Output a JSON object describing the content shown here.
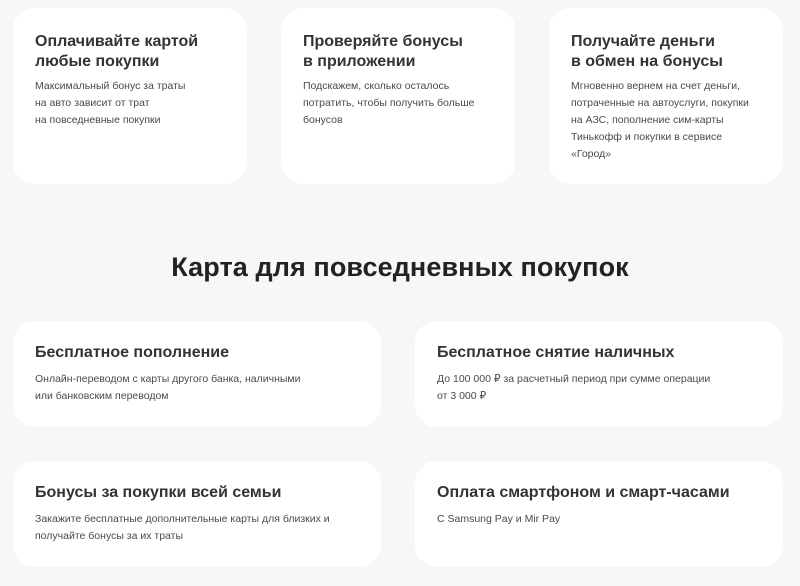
{
  "features": [
    {
      "title": "Оплачивайте картой\nлюбые покупки",
      "text": "Максимальный бонус за траты\nна авто зависит от трат\nна повседневные покупки"
    },
    {
      "title": "Проверяйте бонусы\nв приложении",
      "text": "Подскажем, сколько осталось\nпотратить, чтобы получить больше\nбонусов"
    },
    {
      "title": "Получайте деньги\nв обмен на бонусы",
      "text": "Мгновенно вернем на счет деньги,\nпотраченные на автоуслуги, покупки\nна АЗС, пополнение сим-карты\nТинькофф и покупки в сервисе\n«Город»"
    }
  ],
  "section": {
    "heading": "Карта для повседневных покупок"
  },
  "benefits": [
    {
      "title": "Бесплатное пополнение",
      "text": "Онлайн-переводом с карты другого банка, наличными\nили банковским переводом"
    },
    {
      "title": "Бесплатное снятие наличных",
      "text": "До 100 000 ₽ за расчетный период при сумме операции\nот 3 000 ₽"
    },
    {
      "title": "Бонусы за покупки всей семьи",
      "text": "Закажите бесплатные дополнительные карты для близких и\nполучайте бонусы за их траты"
    },
    {
      "title": "Оплата смартфоном и смарт-часами",
      "text": "С Samsung Pay и Mir Pay"
    }
  ],
  "colors": {
    "background": "#f6f7f8",
    "card": "#ffffff",
    "title": "#333333",
    "text": "#4a4a4a"
  }
}
